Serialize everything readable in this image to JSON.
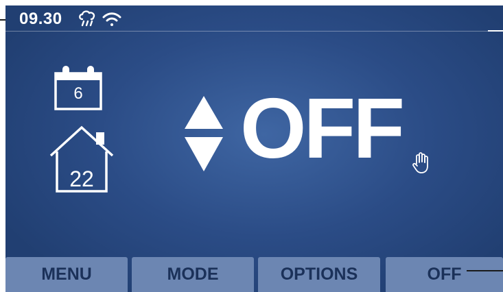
{
  "status_bar": {
    "time": "09.30",
    "weather_icon": "rain-cloud-icon",
    "wifi_icon": "wifi-icon"
  },
  "left_panel": {
    "calendar_icon": "calendar-icon",
    "program_day": "6",
    "house_icon": "house-icon",
    "room_temperature": "22"
  },
  "main": {
    "adjust_icon": "up-down-arrows-icon",
    "mode_value": "OFF",
    "manual_icon": "hand-icon"
  },
  "bottom_menu": {
    "buttons": [
      {
        "label": "MENU"
      },
      {
        "label": "MODE"
      },
      {
        "label": "OPTIONS"
      },
      {
        "label": "OFF"
      }
    ]
  },
  "colors": {
    "screen_bg": "#2b4c86",
    "button_bg": "#6c86b2",
    "button_text": "#1b3159",
    "foreground": "#ffffff"
  }
}
